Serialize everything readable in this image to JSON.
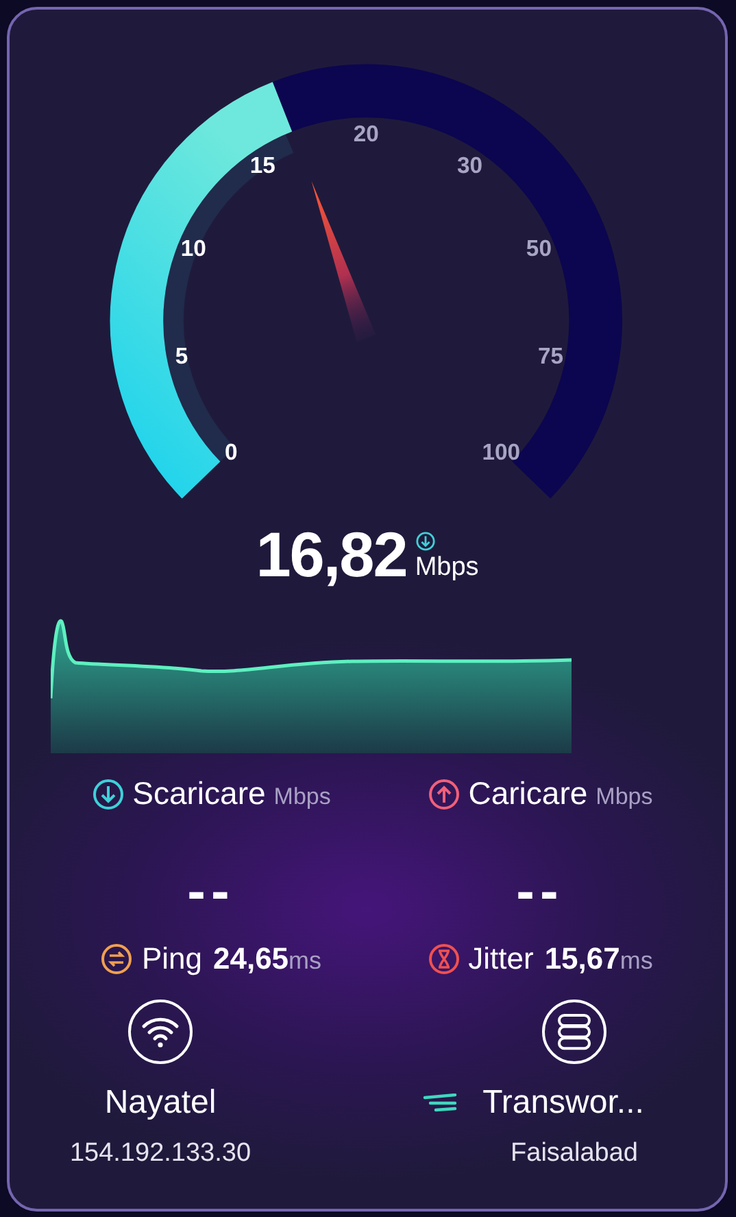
{
  "gauge": {
    "ticks": [
      "0",
      "5",
      "10",
      "15",
      "20",
      "30",
      "50",
      "75",
      "100"
    ]
  },
  "speed": {
    "value": "16,82",
    "unit": "Mbps"
  },
  "results": [
    {
      "kind": "download",
      "label": "Scaricare",
      "unit": "Mbps",
      "value": "--"
    },
    {
      "kind": "upload",
      "label": "Caricare",
      "unit": "Mbps",
      "value": "--"
    }
  ],
  "latency": [
    {
      "kind": "ping",
      "label": "Ping",
      "value": "24,65",
      "unit": "ms"
    },
    {
      "kind": "jitter",
      "label": "Jitter",
      "value": "15,67",
      "unit": "ms"
    }
  ],
  "provider": {
    "name": "Nayatel",
    "address": "154.192.133.30"
  },
  "server": {
    "name": "Transwor...",
    "location": "Faisalabad"
  }
}
